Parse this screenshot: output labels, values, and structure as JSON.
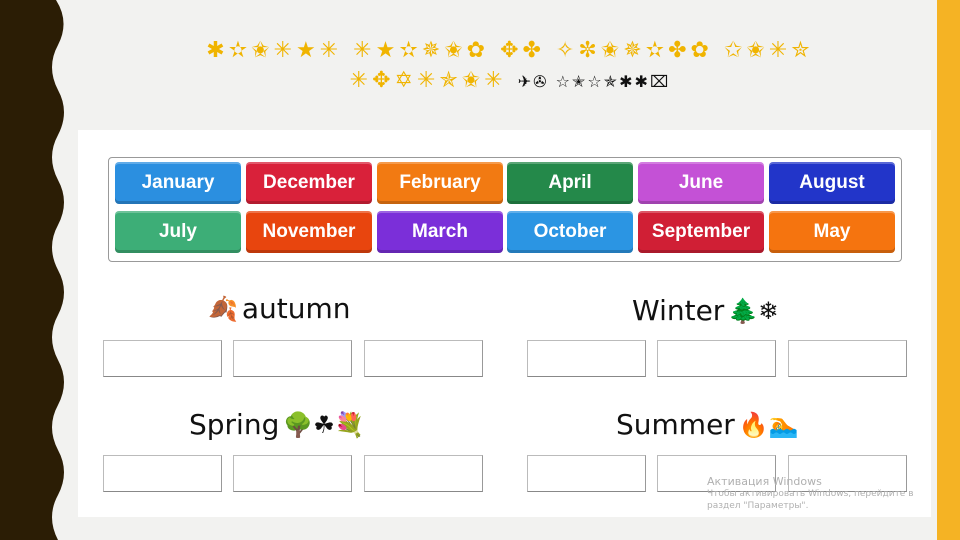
{
  "slide": {
    "title_line1": "✱✫✬✳★✳ ✳★✫✵✬✿ ✥✤ ✧✼✬✵✫✤✿ ✩✬✳✮",
    "title_line2": "✳✥✡✳✯✬✳",
    "title_line2_suffix": "✈✇ ☆✭☆✯✱✱⌧",
    "colors": {
      "title": "#f0b400",
      "accent_bar": "#f5b324",
      "left_band": "#2b1d05"
    }
  },
  "word_bank": {
    "chips": [
      {
        "label": "January",
        "color": "#2b8fe0"
      },
      {
        "label": "December",
        "color": "#d9213a"
      },
      {
        "label": "February",
        "color": "#f27a12"
      },
      {
        "label": "April",
        "color": "#24894a"
      },
      {
        "label": "June",
        "color": "#c451d6"
      },
      {
        "label": "August",
        "color": "#2235c9"
      },
      {
        "label": "July",
        "color": "#3dae77"
      },
      {
        "label": "November",
        "color": "#e8450e"
      },
      {
        "label": "March",
        "color": "#7b2fd9"
      },
      {
        "label": "October",
        "color": "#2b95e3"
      },
      {
        "label": "September",
        "color": "#d01f35"
      },
      {
        "label": "May",
        "color": "#f5740f"
      }
    ]
  },
  "groups": [
    {
      "name": "autumn",
      "emoji_before": "🍂",
      "emoji_after": "",
      "slots": 3
    },
    {
      "name": "Winter",
      "emoji_before": "",
      "emoji_after": "🌲❄",
      "slots": 3
    },
    {
      "name": "Spring",
      "emoji_before": "",
      "emoji_after": "🌳☘💐",
      "slots": 3
    },
    {
      "name": "Summer",
      "emoji_before": "",
      "emoji_after": "🔥🏊",
      "slots": 3
    }
  ],
  "watermark": {
    "title": "Активация Windows",
    "line1": "Чтобы активировать Windows, перейдите в",
    "line2": "раздел \"Параметры\"."
  }
}
